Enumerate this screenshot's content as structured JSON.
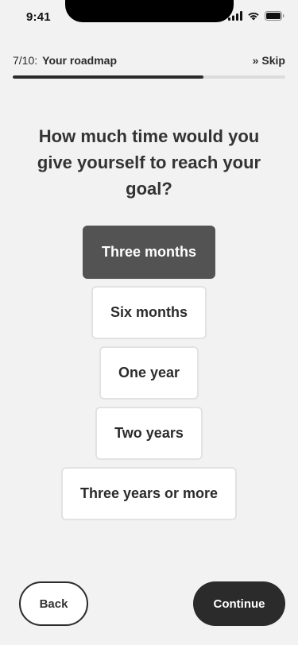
{
  "status_bar": {
    "time": "9:41",
    "icons": [
      "cellular-signal-icon",
      "wifi-icon",
      "battery-icon"
    ]
  },
  "header": {
    "step_counter": "7/10:",
    "title": "Your roadmap",
    "skip_icon": "»",
    "skip_label": "Skip",
    "progress_fraction": 0.7
  },
  "question": {
    "text": "How much time would you give yourself to reach your goal?"
  },
  "options": [
    {
      "label": "Three months",
      "selected": true
    },
    {
      "label": "Six months",
      "selected": false
    },
    {
      "label": "One year",
      "selected": false
    },
    {
      "label": "Two years",
      "selected": false
    },
    {
      "label": "Three years or more",
      "selected": false
    }
  ],
  "footer": {
    "back_label": "Back",
    "continue_label": "Continue"
  },
  "colors": {
    "background": "#f2f2f2",
    "text": "#2b2b2b",
    "selected_option": "#535353",
    "primary_button": "#2b2b2b",
    "progress_track": "#dcdcdc"
  }
}
